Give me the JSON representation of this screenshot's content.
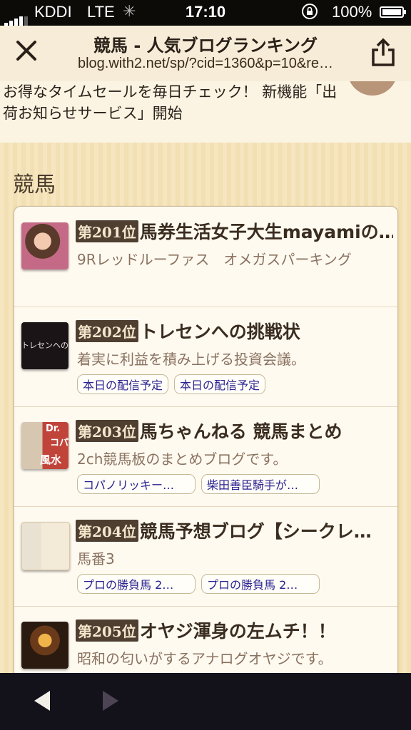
{
  "status": {
    "carrier": "KDDI",
    "network": "LTE",
    "time": "17:10",
    "battery": "100%"
  },
  "browser": {
    "title": "競馬 - 人気ブログランキング",
    "url": "blog.with2.net/sp/?cid=1360&p=10&re…"
  },
  "banner": {
    "text": "お得なタイムセールを毎日チェック！ 新機能「出荷お知らせサービス」開始"
  },
  "section": {
    "title": "競馬"
  },
  "items": [
    {
      "rank": "第201位",
      "name": "馬券生活女子大生mayamiの…",
      "desc": "9Rレッドルーファス　オメガスパーキング",
      "tags": []
    },
    {
      "rank": "第202位",
      "name": "トレセンへの挑戦状",
      "desc": "着実に利益を積み上げる投資会議。",
      "tags": [
        "本日の配信予定",
        "本日の配信予定"
      ]
    },
    {
      "rank": "第203位",
      "name": "馬ちゃんねる 競馬まとめ",
      "desc": "2ch競馬板のまとめブログです。",
      "tags": [
        "コパノリッキー…",
        "柴田善臣騎手が…"
      ]
    },
    {
      "rank": "第204位",
      "name": "競馬予想ブログ【シークレ…",
      "desc": "馬番3",
      "tags": [
        "プロの勝負馬 2…",
        "プロの勝負馬 2…"
      ]
    },
    {
      "rank": "第205位",
      "name": "オヤジ渾身の左ムチ！！",
      "desc": "昭和の匂いがするアナログオヤジです。",
      "tags": []
    }
  ],
  "thumb_texts": {
    "t202": "トレセンへの",
    "t203a": "Dr.",
    "t203b": "コパ",
    "t203c": "風水"
  }
}
